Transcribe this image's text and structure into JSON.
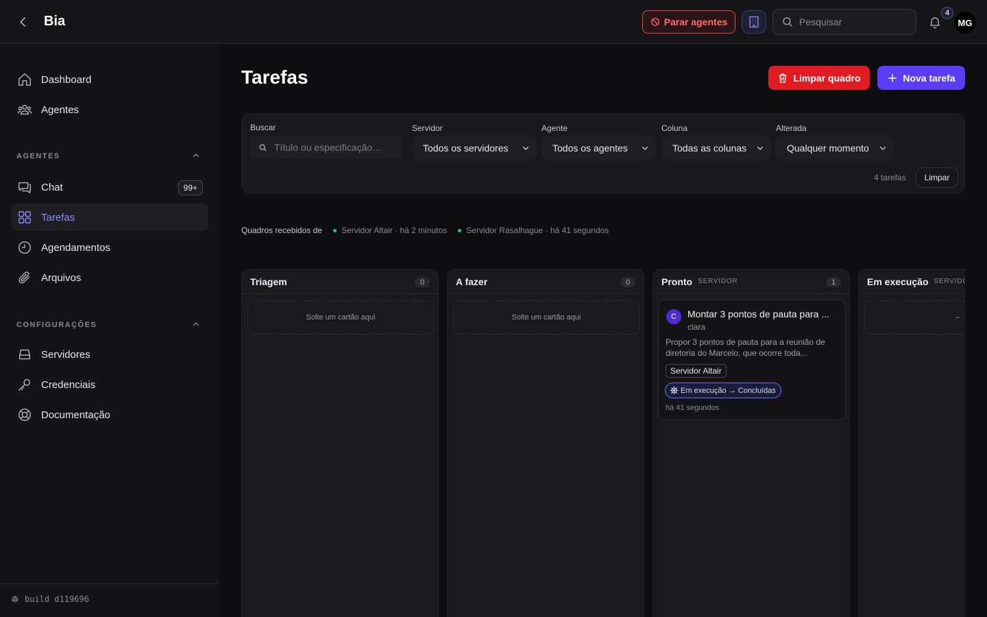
{
  "header": {
    "app_title": "Bia",
    "stop_agents_label": "Parar agentes",
    "search_placeholder": "Pesquisar",
    "notification_count": "4",
    "user_initials": "MG"
  },
  "sidebar": {
    "main_items": [
      {
        "label": "Dashboard",
        "icon": "home-icon"
      },
      {
        "label": "Agentes",
        "icon": "users-icon"
      }
    ],
    "agents_section": {
      "title": "AGENTES",
      "items": [
        {
          "label": "Chat",
          "icon": "chat-icon",
          "badge": "99+"
        },
        {
          "label": "Tarefas",
          "icon": "grid-icon",
          "active": true
        },
        {
          "label": "Agendamentos",
          "icon": "clock-icon"
        },
        {
          "label": "Arquivos",
          "icon": "paperclip-icon"
        }
      ]
    },
    "settings_section": {
      "title": "CONFIGURAÇÕES",
      "items": [
        {
          "label": "Servidores",
          "icon": "server-icon"
        },
        {
          "label": "Credenciais",
          "icon": "key-icon"
        },
        {
          "label": "Documentação",
          "icon": "lifebuoy-icon"
        }
      ]
    },
    "build_label": "build d119696"
  },
  "main": {
    "title": "Tarefas",
    "clear_board_label": "Limpar quadro",
    "new_task_label": "Nova tarefa"
  },
  "filters": {
    "search_label": "Buscar",
    "search_placeholder": "Título ou especificação…",
    "server_label": "Servidor",
    "server_value": "Todos os servidores",
    "agent_label": "Agente",
    "agent_value": "Todos os agentes",
    "column_label": "Coluna",
    "column_value": "Todas as colunas",
    "changed_label": "Alterada",
    "changed_value": "Qualquer momento",
    "count_text": "4 tarefas",
    "clear_label": "Limpar"
  },
  "received": {
    "lead": "Quadros recebidos de",
    "servers": [
      {
        "text": "Servidor Altair · há 2 minutos"
      },
      {
        "text": "Servidor Rasalhague · há 41 segundos"
      }
    ],
    "status_color": "#2ec27e"
  },
  "board": {
    "columns": [
      {
        "title": "Triagem",
        "subtitle": "",
        "count": "0",
        "dropzone": "Solte um cartão aqui"
      },
      {
        "title": "A fazer",
        "subtitle": "",
        "count": "0",
        "dropzone": "Solte um cartão aqui"
      },
      {
        "title": "Pronto",
        "subtitle": "SERVIDOR",
        "count": "1"
      },
      {
        "title": "Em execução",
        "subtitle": "SERVIDOR",
        "dropzone": "–"
      }
    ],
    "card": {
      "avatar": "C",
      "title": "Montar 3 pontos de pauta para ...",
      "author": "clara",
      "description": "Propor 3 pontos de pauta para a reunião de diretoria do Marcelo, que ocorre toda...",
      "tag": "Servidor Altair",
      "flow": "Em execução → Concluídas",
      "time": "há 41 segundos"
    }
  },
  "colors": {
    "accent": "#5b3df5",
    "danger": "#e01b22",
    "active_nav": "#8b8cff"
  }
}
